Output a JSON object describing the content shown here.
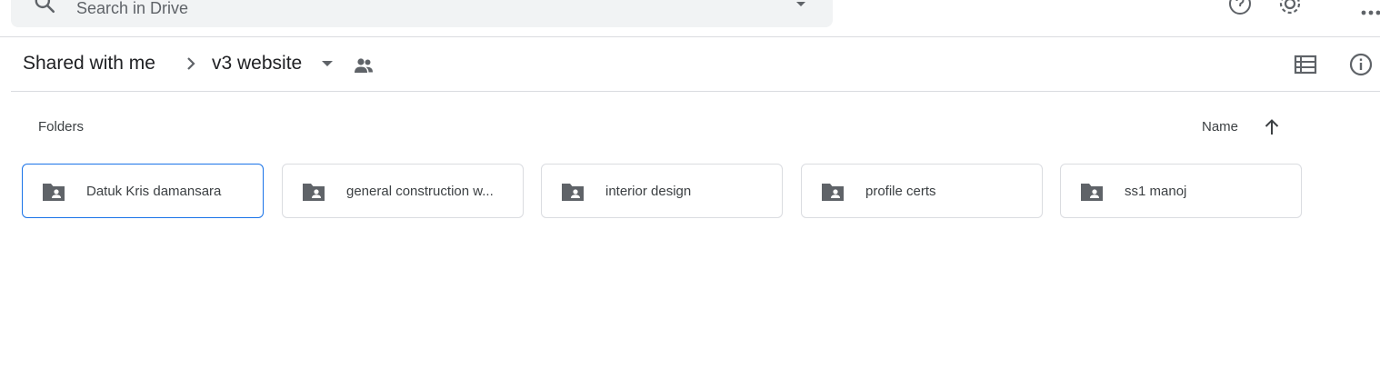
{
  "search": {
    "placeholder": "Search in Drive"
  },
  "breadcrumb": {
    "root": "Shared with me",
    "current": "v3 website"
  },
  "folders_section": {
    "label": "Folders",
    "sort_label": "Name",
    "sort_direction": "ascending"
  },
  "folders": [
    {
      "name": "Datuk Kris damansara",
      "selected": true
    },
    {
      "name": "general construction w...",
      "selected": false
    },
    {
      "name": "interior design",
      "selected": false
    },
    {
      "name": "profile certs",
      "selected": false
    },
    {
      "name": "ss1 manoj",
      "selected": false
    }
  ],
  "colors": {
    "accent": "#1a73e8",
    "icon": "#5f6368",
    "border": "#dadce0",
    "search_bg": "#f1f3f4"
  },
  "icons": {
    "search": "search-icon",
    "help": "help-icon",
    "settings": "gear-icon",
    "apps": "apps-grid-icon",
    "list_view": "list-view-icon",
    "info": "info-icon",
    "shared": "people-icon",
    "folder": "shared-folder-icon"
  }
}
